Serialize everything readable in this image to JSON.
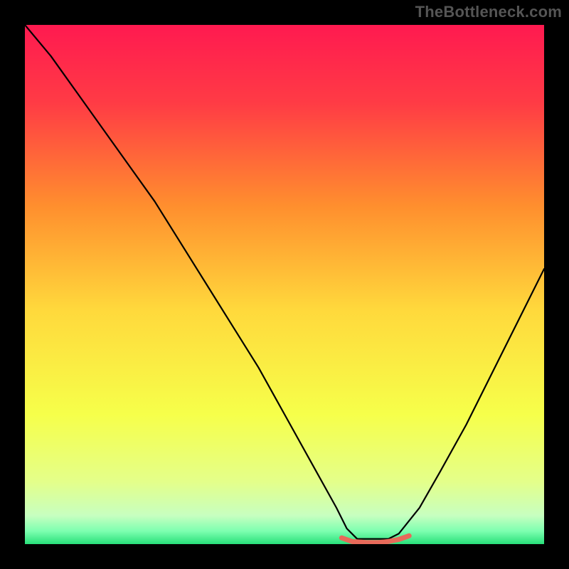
{
  "attribution": "TheBottleneck.com",
  "chart_data": {
    "type": "line",
    "title": "",
    "xlabel": "",
    "ylabel": "",
    "xlim": [
      0,
      100
    ],
    "ylim": [
      0,
      100
    ],
    "grid": false,
    "background_gradient": {
      "stops": [
        {
          "offset": 0.0,
          "color": "#ff1a50"
        },
        {
          "offset": 0.15,
          "color": "#ff3b45"
        },
        {
          "offset": 0.35,
          "color": "#ff8f2e"
        },
        {
          "offset": 0.55,
          "color": "#ffd93c"
        },
        {
          "offset": 0.75,
          "color": "#f6ff4a"
        },
        {
          "offset": 0.88,
          "color": "#e4ff8a"
        },
        {
          "offset": 0.945,
          "color": "#c7ffc0"
        },
        {
          "offset": 0.975,
          "color": "#7dffb0"
        },
        {
          "offset": 1.0,
          "color": "#28e07a"
        }
      ]
    },
    "series": [
      {
        "name": "bottleneck-curve",
        "color": "#000000",
        "width": 2.2,
        "x": [
          0,
          5,
          10,
          15,
          20,
          25,
          30,
          35,
          40,
          45,
          50,
          55,
          60,
          62,
          64,
          67,
          70,
          72,
          76,
          80,
          85,
          90,
          95,
          100
        ],
        "y": [
          100,
          94,
          87,
          80,
          73,
          66,
          58,
          50,
          42,
          34,
          25,
          16,
          7,
          3,
          1,
          1,
          1,
          2,
          7,
          14,
          23,
          33,
          43,
          53
        ]
      },
      {
        "name": "valley-marker",
        "color": "#e86a5a",
        "width": 7,
        "x": [
          61,
          63,
          66,
          68,
          70,
          72,
          74
        ],
        "y": [
          1.2,
          0.5,
          0.3,
          0.3,
          0.5,
          0.9,
          1.6
        ]
      }
    ]
  }
}
